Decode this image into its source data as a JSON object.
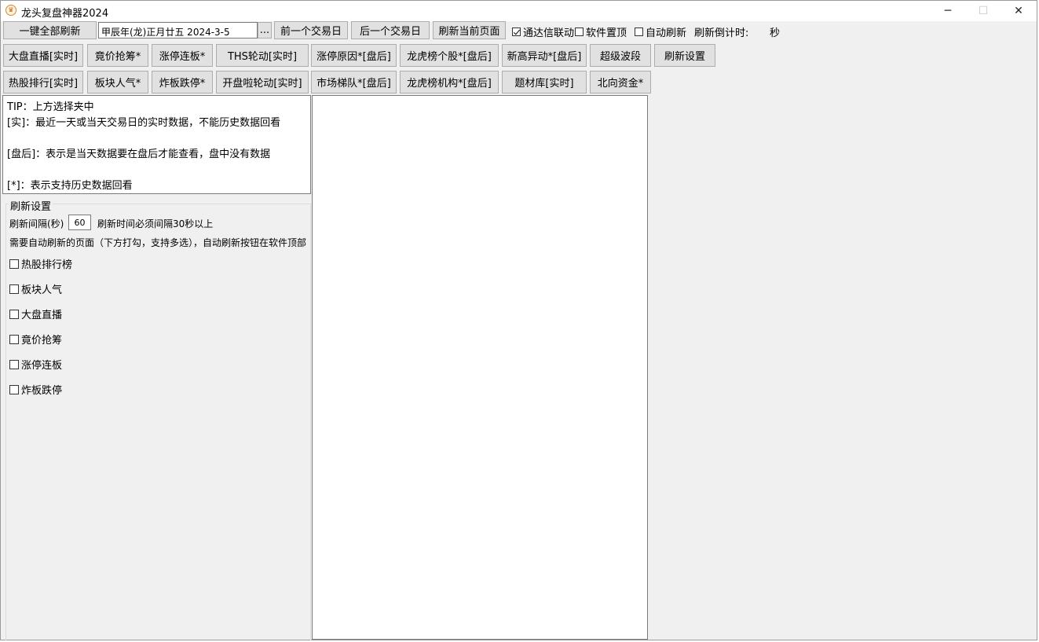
{
  "window": {
    "title": "龙头复盘神器2024",
    "icon": "app-logo-icon",
    "controls": {
      "minimize": "─",
      "maximize": "☐",
      "close": "✕"
    }
  },
  "toolbar": {
    "refresh_all": "一键全部刷新",
    "date_value": "甲辰年(龙)正月廿五  2024-3-5",
    "date_picker": "...",
    "prev_day": "前一个交易日",
    "next_day": "后一个交易日",
    "refresh_page": "刷新当前页面",
    "tdx_link": {
      "label": "通达信联动",
      "checked": true
    },
    "always_on_top": {
      "label": "软件置顶",
      "checked": false
    },
    "auto_refresh": {
      "label": "自动刷新",
      "checked": false
    },
    "countdown_label": "刷新倒计时:",
    "countdown_unit": "秒"
  },
  "nav_row1": [
    "大盘直播[实时]",
    "竟价抢筹*",
    "涨停连板*",
    "THS轮动[实时]",
    "涨停原因*[盘后]",
    "龙虎榜个股*[盘后]",
    "新高异动*[盘后]",
    "超级波段",
    "刷新设置"
  ],
  "nav_row2": [
    "热股排行[实时]",
    "板块人气*",
    "炸板跌停*",
    "开盘啦轮动[实时]",
    "市场梯队*[盘后]",
    "龙虎榜机构*[盘后]",
    "题材库[实时]",
    "北向资金*"
  ],
  "tips": {
    "line1": "TIP：上方选择夹中",
    "line2": "[实]：最近一天或当天交易日的实时数据，不能历史数据回看",
    "line3": "[盘后]：表示是当天数据要在盘后才能查看，盘中没有数据",
    "line4": "[*]：表示支持历史数据回看"
  },
  "refresh_settings": {
    "title": "刷新设置",
    "interval_label": "刷新间隔(秒)",
    "interval_value": "60",
    "interval_note": "刷新时间必须间隔30秒以上",
    "pages_note": "需要自动刷新的页面（下方打勾，支持多选），自动刷新按钮在软件顶部",
    "pages": [
      {
        "label": "热股排行榜",
        "checked": false
      },
      {
        "label": "板块人气",
        "checked": false
      },
      {
        "label": "大盘直播",
        "checked": false
      },
      {
        "label": "竟价抢筹",
        "checked": false
      },
      {
        "label": "涨停连板",
        "checked": false
      },
      {
        "label": "炸板跌停",
        "checked": false
      }
    ]
  }
}
